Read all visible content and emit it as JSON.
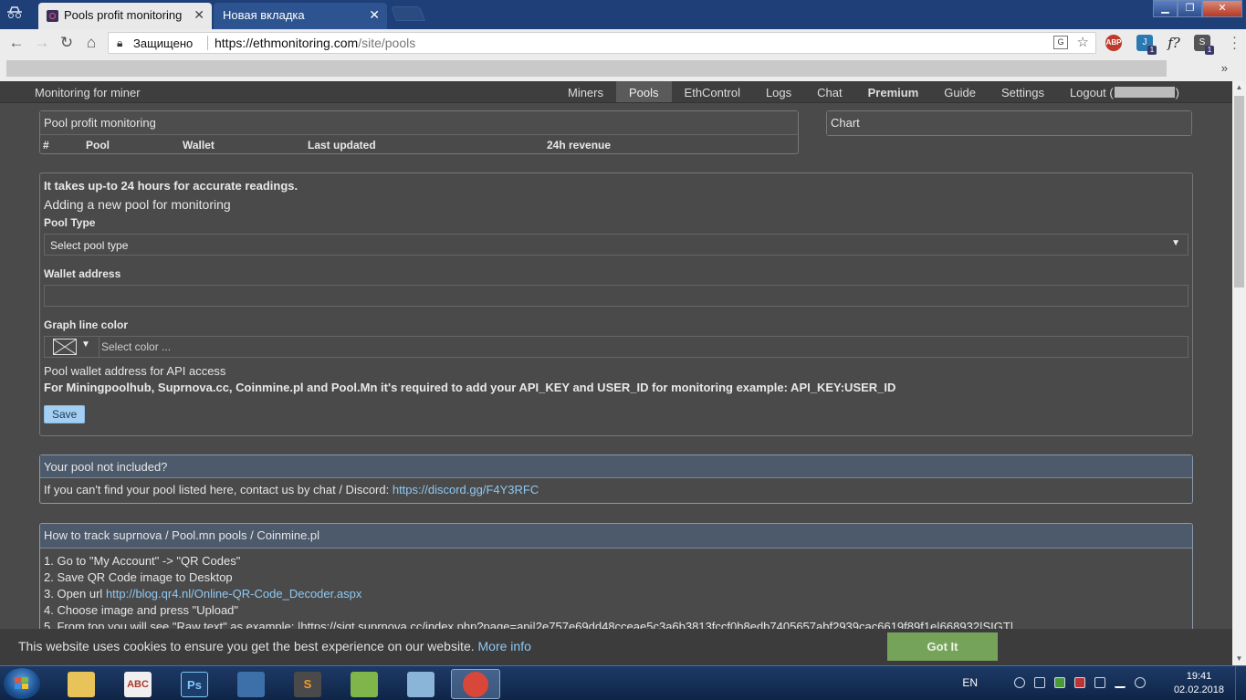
{
  "browser": {
    "tabs": [
      {
        "title": "Pools profit monitoring",
        "active": true
      },
      {
        "title": "Новая вкладка",
        "active": false
      }
    ],
    "secure_label": "Защищено",
    "url_host": "https://ethmonitoring.com",
    "url_path": "/site/pools",
    "extensions": [
      {
        "name": "adblock-icon",
        "label": "ABP",
        "badge": ""
      },
      {
        "name": "extension-j-icon",
        "label": "J",
        "badge": "1"
      },
      {
        "name": "extension-f-icon",
        "label": "f?",
        "badge": ""
      },
      {
        "name": "extension-s-icon",
        "label": "S",
        "badge": "1"
      }
    ],
    "bookmarks_more": "»"
  },
  "site": {
    "brand": "Monitoring for miner",
    "nav": [
      {
        "label": "Miners",
        "active": false,
        "bold": false
      },
      {
        "label": "Pools",
        "active": true,
        "bold": false
      },
      {
        "label": "EthControl",
        "active": false,
        "bold": false
      },
      {
        "label": "Logs",
        "active": false,
        "bold": false
      },
      {
        "label": "Chat",
        "active": false,
        "bold": false
      },
      {
        "label": "Premium",
        "active": false,
        "bold": true
      },
      {
        "label": "Guide",
        "active": false,
        "bold": false
      },
      {
        "label": "Settings",
        "active": false,
        "bold": false
      }
    ],
    "logout_prefix": "Logout (",
    "logout_suffix": ")"
  },
  "pool_table": {
    "title": "Pool profit monitoring",
    "columns": [
      "#",
      "Pool",
      "Wallet",
      "Last updated",
      "24h revenue"
    ]
  },
  "chart_panel": {
    "title": "Chart"
  },
  "add_form": {
    "notice": "It takes up-to 24 hours for accurate readings.",
    "heading": "Adding a new pool for monitoring",
    "pool_type_label": "Pool Type",
    "pool_type_value": "Select pool type",
    "wallet_label": "Wallet address",
    "wallet_value": "",
    "color_label": "Graph line color",
    "color_placeholder": "Select color ...",
    "api_hint": "Pool wallet address for API access",
    "api_note": "For Miningpoolhub, Suprnova.cc, Coinmine.pl and Pool.Mn it's required to add your API_KEY and USER_ID for monitoring example: API_KEY:USER_ID",
    "save_label": "Save"
  },
  "not_included": {
    "title": "Your pool not included?",
    "text": "If you can't find your pool listed here, contact us by chat / Discord: ",
    "link": "https://discord.gg/F4Y3RFC"
  },
  "howto": {
    "title": "How to track suprnova / Pool.mn pools / Coinmine.pl",
    "step1": "1. Go to \"My Account\" -> \"QR Codes\"",
    "step2": "2. Save QR Code image to Desktop",
    "step3_prefix": "3. Open url ",
    "step3_link": "http://blog.qr4.nl/Online-QR-Code_Decoder.aspx",
    "step4": "4. Choose image and press \"Upload\"",
    "step5": "5. From top you will see \"Raw text\" as example: |https://sigt.suprnova.cc/index.php?page=api|2e757e69dd48cceae5c3a6b3813fccf0b8edb7405657abf2939cac6619f89f1e|668932|SIGT|"
  },
  "cookie": {
    "message": "This website uses cookies to ensure you get the best experience on our website. ",
    "more": "More info",
    "button": "Got It"
  },
  "taskbar": {
    "lang": "EN",
    "time": "19:41",
    "date": "02.02.2018",
    "apps": [
      {
        "name": "explorer-app-icon",
        "label": "",
        "color": "#e8c35a"
      },
      {
        "name": "abc-net-app-icon",
        "label": "ABC",
        "color": "#f0f0f0"
      },
      {
        "name": "photoshop-app-icon",
        "label": "Ps",
        "color": "#1d3d6b"
      },
      {
        "name": "python-app-icon",
        "label": "",
        "color": "#3d6fa8"
      },
      {
        "name": "sublime-app-icon",
        "label": "S",
        "color": "#4a4a4a"
      },
      {
        "name": "notepad-app-icon",
        "label": "",
        "color": "#7fb54a"
      },
      {
        "name": "paper-app-icon",
        "label": "",
        "color": "#8ab4d8"
      },
      {
        "name": "chrome-app-icon",
        "label": "",
        "color": "#d9463a"
      }
    ]
  }
}
